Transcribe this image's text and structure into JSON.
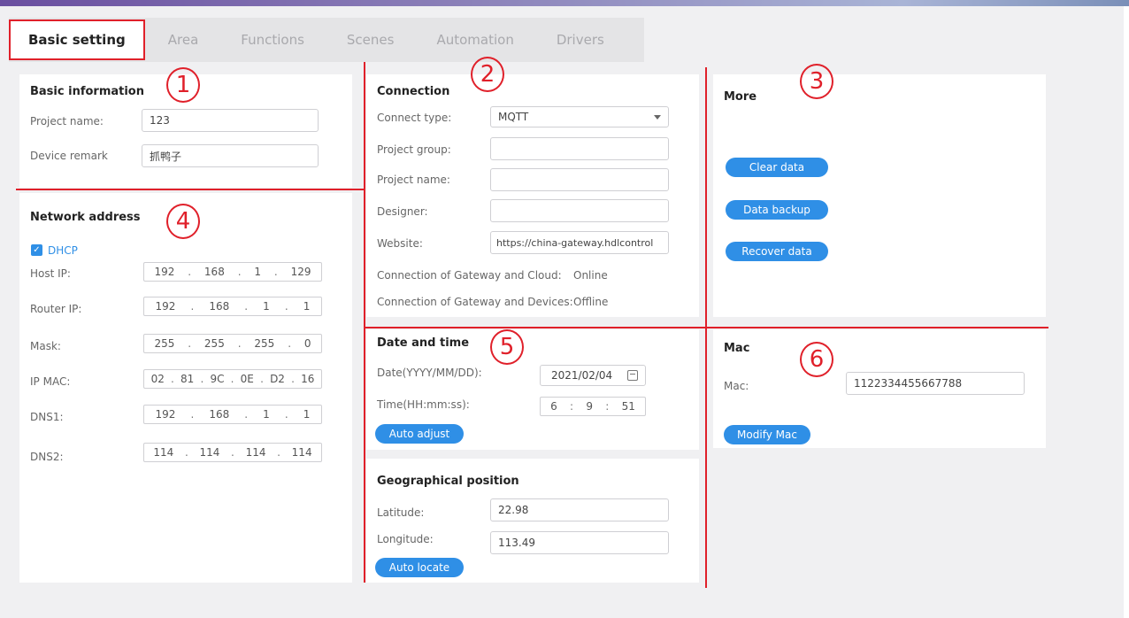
{
  "tabs": [
    {
      "label": "Basic setting"
    },
    {
      "label": "Area"
    },
    {
      "label": "Functions"
    },
    {
      "label": "Scenes"
    },
    {
      "label": "Automation"
    },
    {
      "label": "Drivers"
    }
  ],
  "markers": [
    "1",
    "2",
    "3",
    "4",
    "5",
    "6"
  ],
  "basic_info": {
    "title": "Basic information",
    "project_name_label": "Project name:",
    "project_name_value": "123",
    "device_remark_label": "Device remark",
    "device_remark_value": "抓鸭子"
  },
  "network": {
    "title": "Network address",
    "dhcp_label": "DHCP",
    "rows": [
      {
        "label": "Host IP:",
        "octets": [
          "192",
          "168",
          "1",
          "129"
        ]
      },
      {
        "label": "Router IP:",
        "octets": [
          "192",
          "168",
          "1",
          "1"
        ]
      },
      {
        "label": "Mask:",
        "octets": [
          "255",
          "255",
          "255",
          "0"
        ]
      },
      {
        "label": "IP MAC:",
        "octets": [
          "02",
          "81",
          "9C",
          "0E",
          "D2",
          "16"
        ]
      },
      {
        "label": "DNS1:",
        "octets": [
          "192",
          "168",
          "1",
          "1"
        ]
      },
      {
        "label": "DNS2:",
        "octets": [
          "114",
          "114",
          "114",
          "114"
        ]
      }
    ]
  },
  "connection": {
    "title": "Connection",
    "connect_type_label": "Connect type:",
    "connect_type_value": "MQTT",
    "project_group_label": "Project group:",
    "project_group_value": "",
    "project_name_label": "Project name:",
    "project_name_value": "",
    "designer_label": "Designer:",
    "designer_value": "",
    "website_label": "Website:",
    "website_value": "https://china-gateway.hdlcontrol",
    "gw_cloud_label": "Connection of Gateway and Cloud:",
    "gw_cloud_status": "Online",
    "gw_devices_label": "Connection of Gateway and Devices:",
    "gw_devices_status": "Offline"
  },
  "more": {
    "title": "More",
    "clear_data": "Clear data",
    "data_backup": "Data backup",
    "recover_data": "Recover data"
  },
  "datetime": {
    "title": "Date and time",
    "date_label": "Date(YYYY/MM/DD):",
    "date_value": "2021/02/04",
    "time_label": "Time(HH:mm:ss):",
    "time_h": "6",
    "time_m": "9",
    "time_s": "51",
    "auto_adjust": "Auto adjust"
  },
  "geo": {
    "title": "Geographical position",
    "latitude_label": "Latitude:",
    "latitude_value": "22.98",
    "longitude_label": "Longitude:",
    "longitude_value": "113.49",
    "auto_locate": "Auto locate"
  },
  "mac": {
    "title": "Mac",
    "mac_label": "Mac:",
    "mac_value": "1122334455667788",
    "modify_mac": "Modify Mac"
  },
  "colors": {
    "accent": "#2f8fe6",
    "annotation": "#e0202a"
  }
}
